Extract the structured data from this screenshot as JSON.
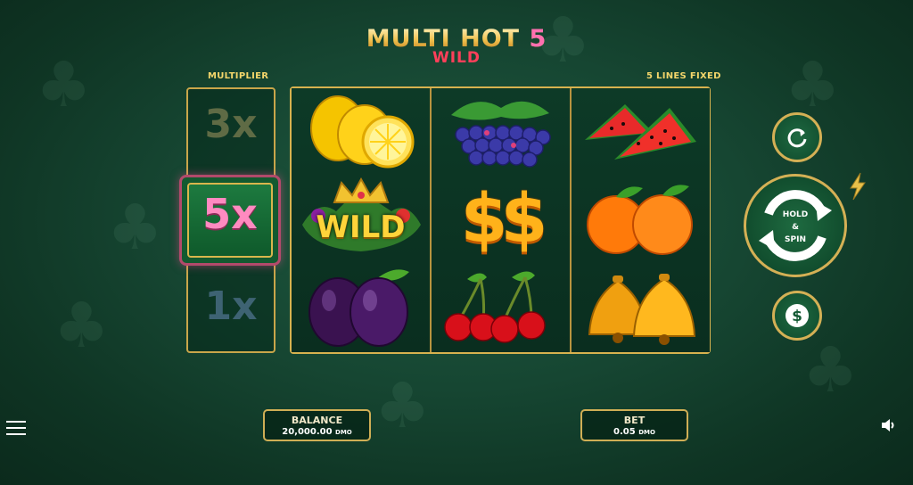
{
  "title": {
    "main": "MULTI HOT ",
    "number": "5",
    "sub": "WILD"
  },
  "labels": {
    "multiplier": "MULTIPLIER",
    "lines": "5 LINES FIXED"
  },
  "multipliers": [
    {
      "value": "3x",
      "active": false
    },
    {
      "value": "5x",
      "active": true
    },
    {
      "value": "1x",
      "active": false
    }
  ],
  "reels": [
    [
      "lemon",
      "wild",
      "plum"
    ],
    [
      "grapes",
      "dollar",
      "cherries"
    ],
    [
      "watermelon",
      "orange",
      "bells"
    ]
  ],
  "wild_text": "WILD",
  "hold_spin": {
    "line1": "HOLD",
    "line2": "&",
    "line3": "SPIN"
  },
  "buttons": {
    "autoplay_icon": "refresh-icon",
    "bet_icon": "dollar-coin-icon",
    "turbo_icon": "lightning-icon"
  },
  "balance": {
    "label": "BALANCE",
    "value": "20,000.00",
    "unit": "DMO"
  },
  "bet": {
    "label": "BET",
    "value": "0.05",
    "unit": "DMO"
  },
  "colors": {
    "gold": "#d4b055",
    "wild_red": "#ff3f5a",
    "multiplier_pink": "#ff8ac0",
    "felt": "#164632"
  }
}
